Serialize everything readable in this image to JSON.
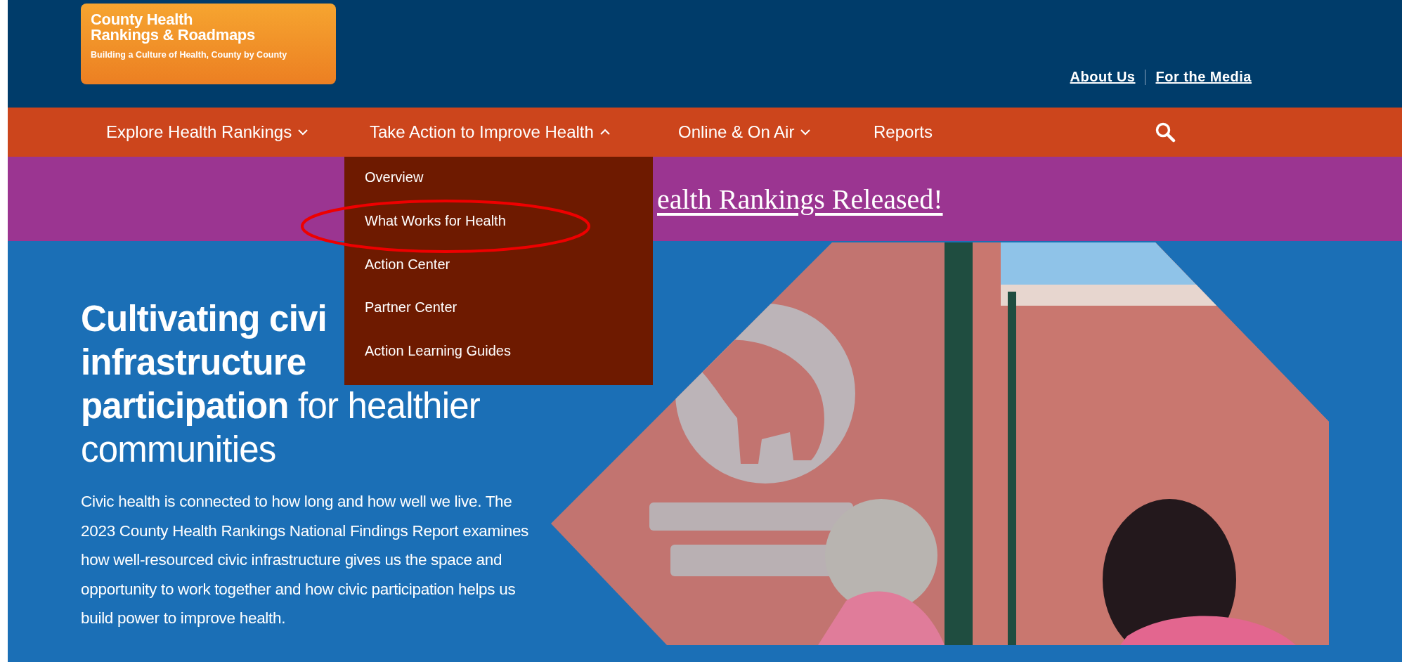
{
  "header": {
    "logo": {
      "title_lines": [
        "County Health",
        "Rankings & Roadmaps"
      ],
      "tagline": "Building a Culture of Health, County by County"
    },
    "utility_links": [
      "About Us",
      "For the Media"
    ]
  },
  "nav": {
    "items": [
      {
        "label": "Explore Health Rankings",
        "kind": "menu",
        "expanded": false
      },
      {
        "label": "Take Action to Improve Health",
        "kind": "menu",
        "expanded": true,
        "submenu": [
          {
            "label": "Overview",
            "circled": false
          },
          {
            "label": "What Works for Health",
            "circled": true
          },
          {
            "label": "Action Center",
            "circled": false
          },
          {
            "label": "Partner Center",
            "circled": false
          },
          {
            "label": "Action Learning Guides",
            "circled": false
          }
        ]
      },
      {
        "label": "Online & On Air",
        "kind": "menu",
        "expanded": false
      },
      {
        "label": "Reports",
        "kind": "link"
      }
    ]
  },
  "banner": {
    "text": "ealth Rankings Released!"
  },
  "hero": {
    "heading_lines": [
      "Cultivating civi",
      "infrastructure",
      "**participation** for healthier",
      "communities"
    ],
    "body": "Civic health is connected to how long and how well we live. The 2023 County Health Rankings National Findings Report examines how well-resourced civic infrastructure gives us the space and opportunity to work together and how civic participation helps us build power to improve health.",
    "picture": {
      "kind": "picture"
    }
  }
}
